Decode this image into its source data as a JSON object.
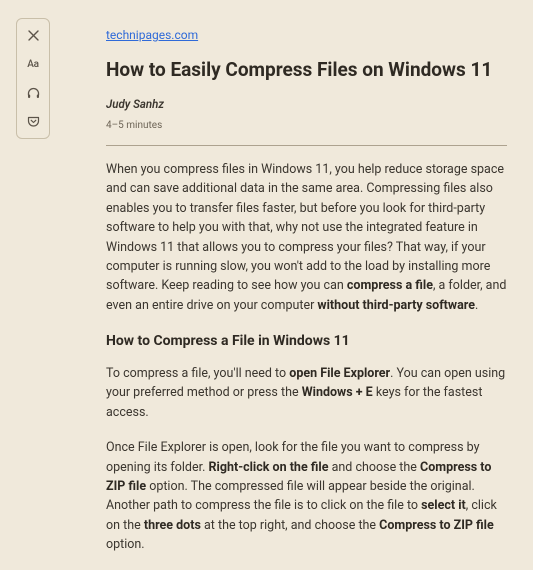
{
  "toolbar": {
    "close_icon": "close-icon",
    "font_label": "Aa",
    "headphones_icon": "headphones-icon",
    "pocket_icon": "pocket-icon"
  },
  "article": {
    "source": "technipages.com",
    "title": "How to Easily Compress Files on Windows 11",
    "author": "Judy Sanhz",
    "minutes": "4–5 minutes",
    "section_heading": "How to Compress a File in Windows 11",
    "p1": {
      "t1": "When you compress files in Windows 11, you help reduce storage space and can save additional data in the same area. Compressing files also enables you to transfer files faster, but before you look for third-party software to help you with that, why not use the integrated feature in Windows 11 that allows you to compress your files? That way, if your computer is running slow, you won't add to the load by installing more software. Keep reading to see how you can ",
      "b1": "compress a file",
      "t2": ", a folder, and even an entire drive on your computer ",
      "b2": "without third-party software",
      "t3": "."
    },
    "p2": {
      "t1": "To compress a file, you'll need to ",
      "b1": "open File Explorer",
      "t2": ". You can open using your preferred method or press the ",
      "b2": "Windows + E",
      "t3": " keys for the fastest access."
    },
    "p3": {
      "t1": "Once File Explorer is open, look for the file you want to compress by opening its folder. ",
      "b1": "Right-click on the file",
      "t2": " and choose the ",
      "b2": "Compress to ZIP file",
      "t3": " option. The compressed file will appear beside the original. Another path to compress the file is to click on the file to ",
      "b3": "select it",
      "t4": ", click on the ",
      "b4": "three dots",
      "t5": " at the top right, and choose the ",
      "b5": "Compress to ZIP file",
      "t6": " option."
    }
  }
}
